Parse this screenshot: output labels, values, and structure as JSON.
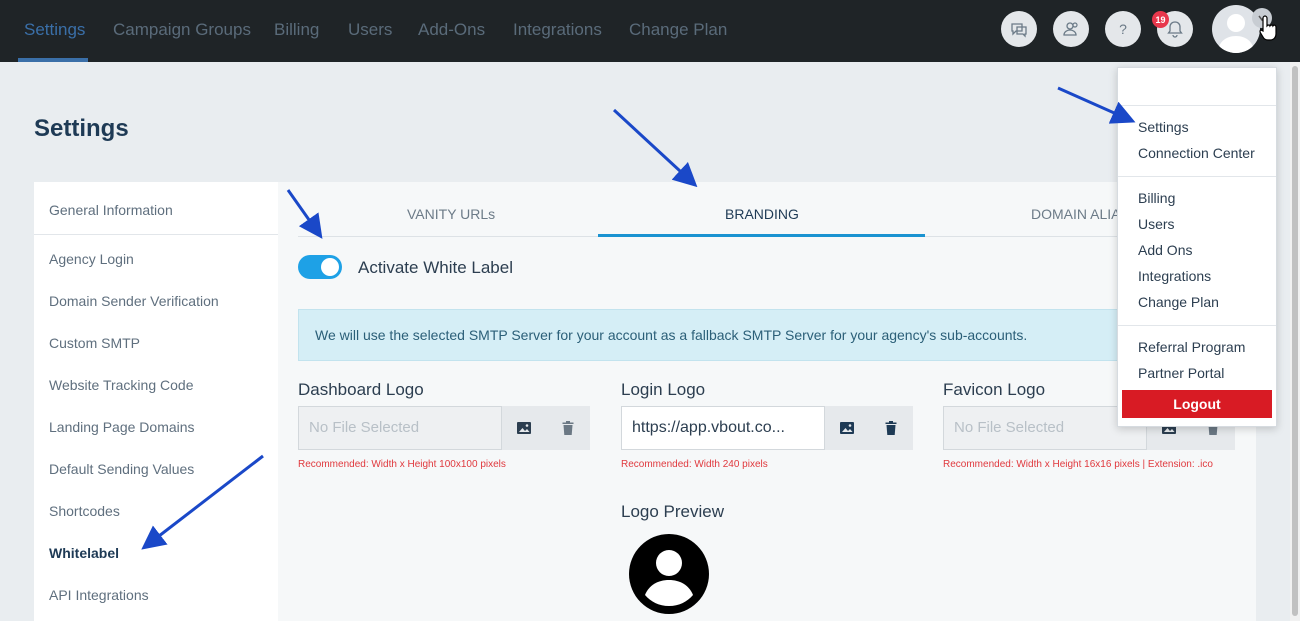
{
  "topnav": {
    "items": [
      "Settings",
      "Campaign Groups",
      "Billing",
      "Users",
      "Add-Ons",
      "Integrations",
      "Change Plan"
    ],
    "notification_count": "19"
  },
  "page": {
    "title": "Settings"
  },
  "sidebar": {
    "items": [
      "General Information",
      "Agency Login",
      "Domain Sender Verification",
      "Custom SMTP",
      "Website Tracking Code",
      "Landing Page Domains",
      "Default Sending Values",
      "Shortcodes",
      "Whitelabel",
      "API Integrations"
    ],
    "active": "Whitelabel"
  },
  "tabs": [
    "VANITY URLs",
    "BRANDING",
    "DOMAIN ALIA"
  ],
  "whitelabel": {
    "toggle_label": "Activate White Label",
    "toggle_on": true,
    "info": "We will use the selected SMTP Server for your account as a fallback SMTP Server for your agency's sub-accounts."
  },
  "logos": [
    {
      "label": "Dashboard Logo",
      "placeholder": "No File Selected",
      "value": "",
      "hint": "Recommended: Width x Height 100x100 pixels"
    },
    {
      "label": "Login Logo",
      "placeholder": "No File Selected",
      "value": "https://app.vbout.co...",
      "hint": "Recommended: Width 240 pixels"
    },
    {
      "label": "Favicon Logo",
      "placeholder": "No File Selected",
      "value": "",
      "hint": "Recommended: Width x Height 16x16 pixels | Extension: .ico"
    }
  ],
  "preview": {
    "label": "Logo Preview"
  },
  "dropdown": {
    "group1": [
      "Settings",
      "Connection Center"
    ],
    "group2": [
      "Billing",
      "Users",
      "Add Ons",
      "Integrations",
      "Change Plan"
    ],
    "group3": [
      "Referral Program",
      "Partner Portal"
    ],
    "logout": "Logout"
  },
  "colors": {
    "accent": "#1a93d1",
    "nav_bg": "#1f2427",
    "danger": "#d81b24",
    "hint": "#e0393e",
    "arrow": "#1a48c8"
  }
}
